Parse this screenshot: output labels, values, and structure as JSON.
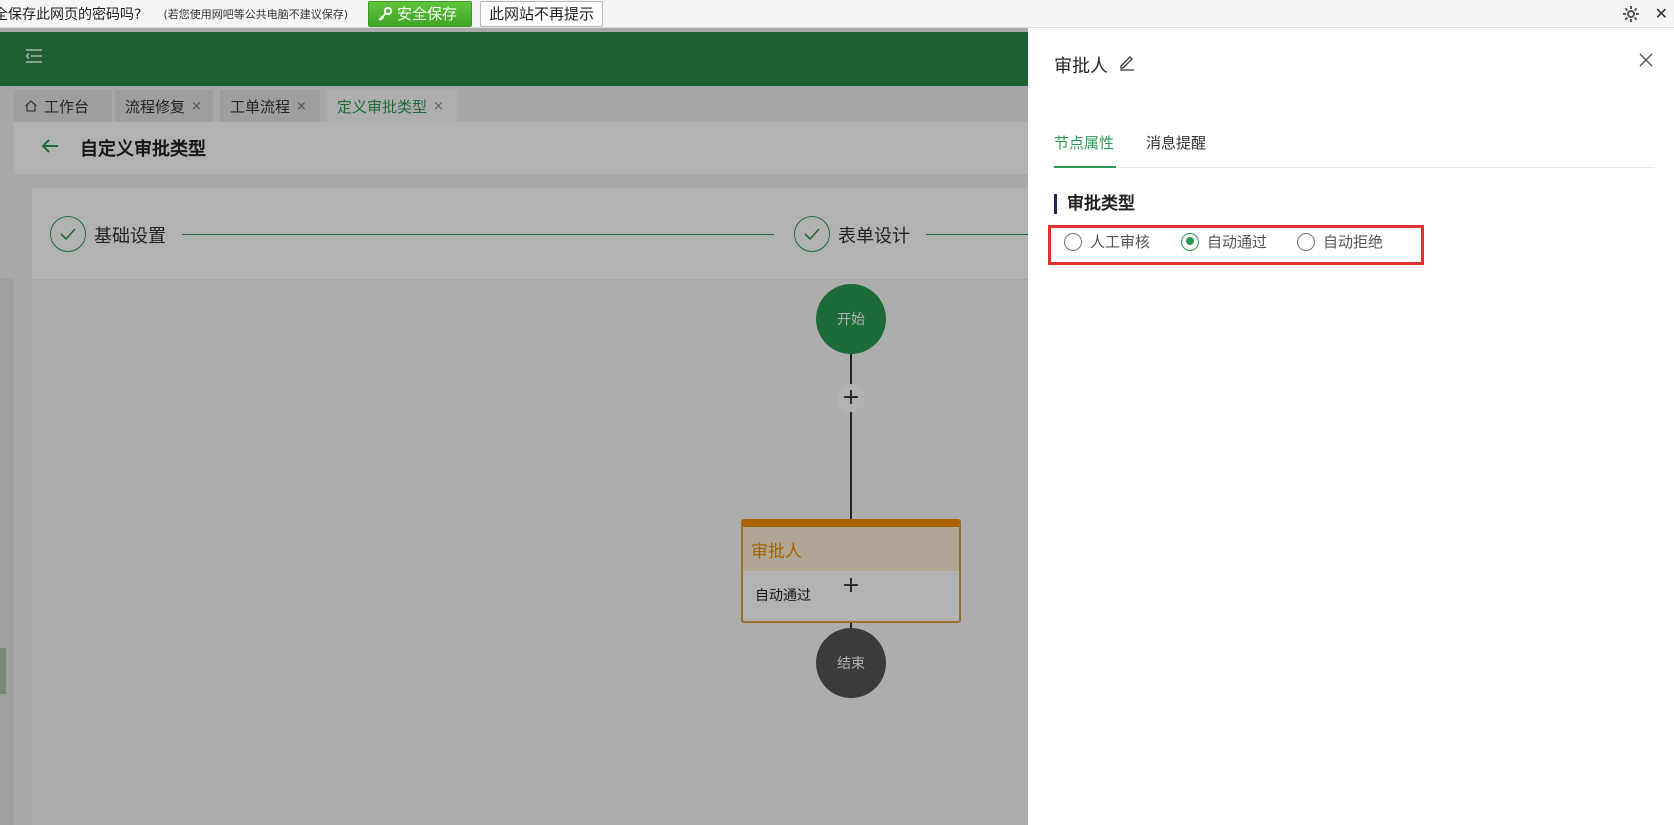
{
  "browser_bar": {
    "question": "全保存此网页的密码吗?",
    "hint": "(若您使用网吧等公共电脑不建议保存)",
    "save_button": "安全保存",
    "no_prompt_button": "此网站不再提示"
  },
  "tabs": [
    {
      "label": "工作台",
      "icon": "home-icon"
    },
    {
      "label": "流程修复",
      "close": "×"
    },
    {
      "label": "工单流程",
      "close": "×"
    },
    {
      "label": "定义审批类型",
      "close": "×",
      "active": true
    }
  ],
  "page": {
    "title": "自定义审批类型"
  },
  "steps": [
    {
      "label": "基础设置",
      "status": "done"
    },
    {
      "label": "表单设计",
      "status": "done"
    }
  ],
  "flow": {
    "start_label": "开始",
    "end_label": "结束",
    "plus_symbol": "+",
    "approver": {
      "title": "审批人",
      "content": "自动通过"
    }
  },
  "drawer": {
    "title": "审批人",
    "tabs": [
      {
        "label": "节点属性",
        "active": true
      },
      {
        "label": "消息提醒"
      }
    ],
    "section_title": "审批类型",
    "options": [
      {
        "label": "人工审核",
        "checked": false
      },
      {
        "label": "自动通过",
        "checked": true
      },
      {
        "label": "自动拒绝",
        "checked": false
      }
    ]
  },
  "colors": {
    "brand_green": "#2a8b45",
    "accent_green": "#2a9a52",
    "approver_orange": "#f08c00",
    "highlight_red": "#e03131",
    "end_node_gray": "#555555"
  }
}
